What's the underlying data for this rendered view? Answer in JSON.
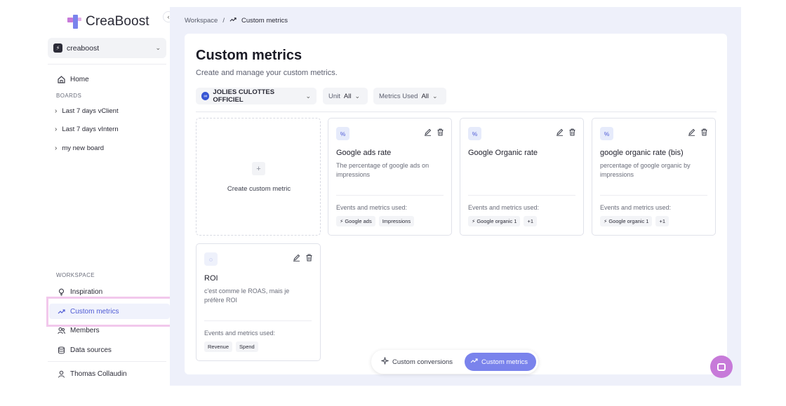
{
  "app": {
    "name": "CreaBoost"
  },
  "sidebar": {
    "workspace": "creaboost",
    "home": "Home",
    "boards_label": "BOARDS",
    "boards": [
      "Last 7 days vClient",
      "Last 7 days vIntern",
      "my new board"
    ],
    "workspace_label": "WORKSPACE",
    "workspace_items": {
      "inspiration": "Inspiration",
      "custom_metrics": "Custom metrics",
      "members": "Members",
      "data_sources": "Data sources"
    },
    "user": "Thomas Collaudin"
  },
  "breadcrumb": {
    "root": "Workspace",
    "sep": "/",
    "current": "Custom metrics"
  },
  "page": {
    "title": "Custom metrics",
    "subtitle": "Create and manage your custom metrics."
  },
  "filters": {
    "account": "JOLIES CULOTTES OFFICIEL",
    "unit_label": "Unit",
    "unit_value": "All",
    "metrics_label": "Metrics Used",
    "metrics_value": "All"
  },
  "create_card": {
    "plus": "+",
    "label": "Create custom metric"
  },
  "cards": [
    {
      "badge": "%",
      "title": "Google ads rate",
      "desc": "The percentage of google ads on impressions",
      "used_label": "Events and metrics used:",
      "tags": [
        "⚡ Google ads",
        "Impressions"
      ]
    },
    {
      "badge": "%",
      "title": "Google Organic rate",
      "desc": "",
      "used_label": "Events and metrics used:",
      "tags": [
        "⚡ Google organic 1",
        "+1"
      ]
    },
    {
      "badge": "%",
      "title": "google organic rate (bis)",
      "desc": "percentage of google organic by impressions",
      "used_label": "Events and metrics used:",
      "tags": [
        "⚡ Google organic 1",
        "+1"
      ]
    },
    {
      "badge": "◌",
      "title": "ROI",
      "desc": "c'est comme le ROAS, mais je préfère ROI",
      "used_label": "Events and metrics used:",
      "tags": [
        "Revenue",
        "Spend"
      ]
    }
  ],
  "switch": {
    "conversions": "Custom conversions",
    "metrics": "Custom metrics"
  },
  "colors": {
    "accent": "#4f5bd5",
    "active_pill": "#7a83ec",
    "chat": "#c77ad9",
    "highlight": "#f2c8ec"
  }
}
